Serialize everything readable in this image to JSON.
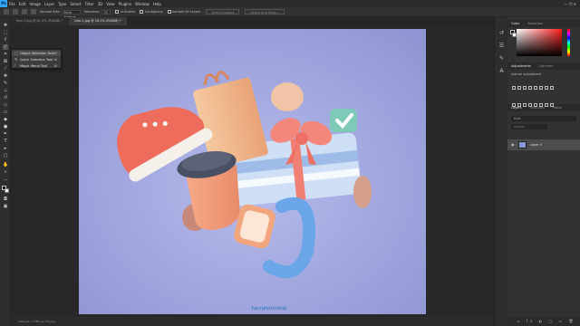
{
  "menubar": {
    "logo": "Ps",
    "items": [
      "File",
      "Edit",
      "Image",
      "Layer",
      "Type",
      "Select",
      "Filter",
      "3D",
      "View",
      "Plugins",
      "Window",
      "Help"
    ]
  },
  "options": {
    "sample_size_label": "Sample Size:",
    "sample_size_value": "Point Sample",
    "tolerance_label": "Tolerance:",
    "tolerance_value": "32",
    "anti_alias": "Anti-alias",
    "contiguous": "Contiguous",
    "sample_all": "Sample All Layers",
    "select_subject": "Select Subject",
    "select_mask": "Select and Mask..."
  },
  "tabs": [
    {
      "label": "foto 2.jpg @ 81,5% (RGB/8) *",
      "active": false
    },
    {
      "label": "foto 2.jpg @ 16,1% (RGB/8) *",
      "active": true
    }
  ],
  "flyout": {
    "items": [
      {
        "label": "Object Selection Tool",
        "key": "W",
        "icon": "object-selection-icon"
      },
      {
        "label": "Quick Selection Tool",
        "key": "W",
        "icon": "quick-selection-icon"
      },
      {
        "label": "Magic Wand Tool",
        "key": "W",
        "icon": "magic-wand-icon"
      }
    ]
  },
  "panels": {
    "color_tabs": [
      "Color",
      "Swatches"
    ],
    "adjustments_tabs": [
      "Adjustments",
      "Libraries"
    ],
    "adjustments_label": "Add an adjustment",
    "layers_tabs": [
      "Layers",
      "Channels",
      "Paths"
    ],
    "kind": "Kind",
    "mode": "Normal",
    "layer_name": "Layer 0"
  },
  "status": "1914 px x 1787 px (72 ppi)",
  "watermark": "fasrphotoshop",
  "colors": {
    "accent": "#31a8ff",
    "canvas_bg": "#a7acd9"
  }
}
